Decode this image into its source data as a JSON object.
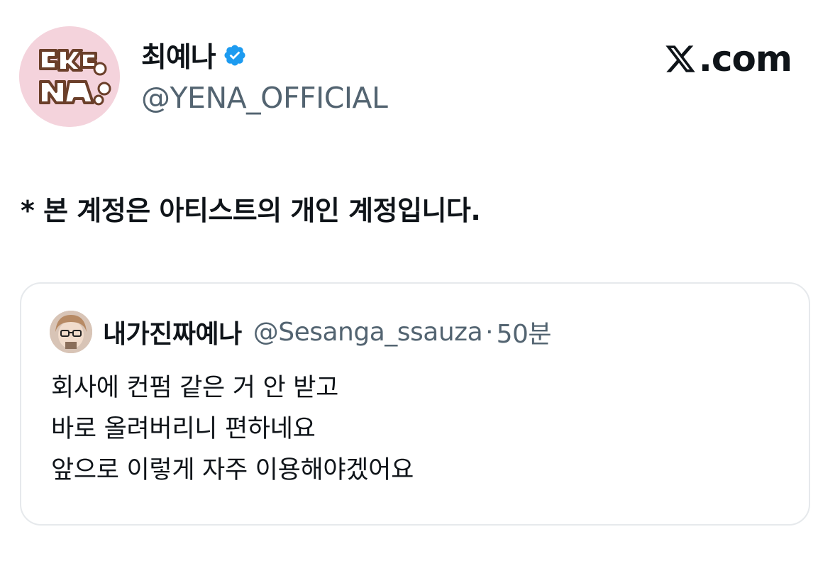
{
  "author": {
    "display_name": "최예나",
    "handle": "@YENA_OFFICIAL",
    "avatar_logo_text": "YENA",
    "verified": true
  },
  "brand": {
    "text": ".com",
    "icon": "x-logo-icon"
  },
  "tweet": {
    "text": "* 본 계정은 아티스트의 개인 계정입니다."
  },
  "quote": {
    "display_name": "내가진짜예나",
    "handle": "@Sesanga_ssauza",
    "separator": "·",
    "time": "50분",
    "lines": [
      "회사에 컨펌 같은 거 안 받고",
      "바로 올려버리니 편하네요",
      "앞으로 이렇게 자주 이용해야겠어요"
    ]
  },
  "colors": {
    "verified_blue": "#1d9bf0",
    "avatar_bg": "#f4d3dc",
    "logo_brown": "#6b3f2a",
    "secondary_text": "#536471",
    "border": "#e6e9ec"
  }
}
